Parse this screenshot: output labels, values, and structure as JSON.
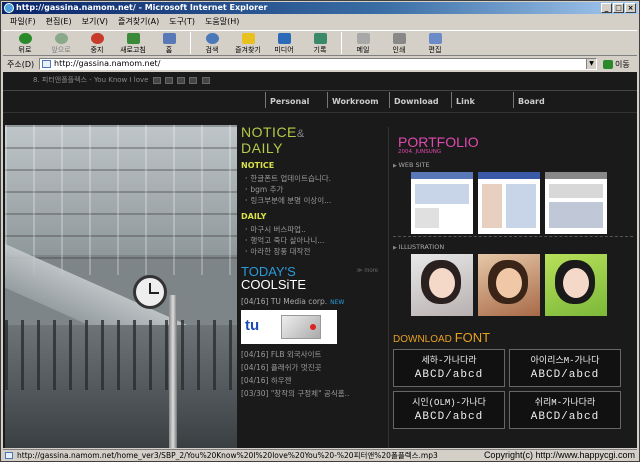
{
  "window": {
    "title": "http://gassina.namom.net/ - Microsoft Internet Explorer"
  },
  "menu": [
    "파일(F)",
    "편집(E)",
    "보기(V)",
    "즐겨찾기(A)",
    "도구(T)",
    "도움말(H)"
  ],
  "toolbar": [
    {
      "label": "뒤로",
      "icon": "back-icon",
      "color": "#2a8a2a"
    },
    {
      "label": "앞으로",
      "icon": "forward-icon",
      "color": "#8aa88a"
    },
    {
      "label": "중지",
      "icon": "stop-icon",
      "color": "#c83a2a"
    },
    {
      "label": "새로고침",
      "icon": "refresh-icon",
      "color": "#3a8a3a"
    },
    {
      "label": "홈",
      "icon": "home-icon",
      "color": "#5878b8"
    },
    {
      "label": "검색",
      "icon": "search-icon",
      "color": "#4a78b8"
    },
    {
      "label": "즐겨찾기",
      "icon": "favorites-icon",
      "color": "#e8c020"
    },
    {
      "label": "미디어",
      "icon": "media-icon",
      "color": "#2a6ab8"
    },
    {
      "label": "기록",
      "icon": "history-icon",
      "color": "#3a8a6a"
    },
    {
      "label": "메일",
      "icon": "mail-icon",
      "color": "#a8a8a8"
    },
    {
      "label": "인쇄",
      "icon": "print-icon",
      "color": "#888888"
    },
    {
      "label": "편집",
      "icon": "edit-icon",
      "color": "#6a8ac8"
    }
  ],
  "address": {
    "label": "주소(D)",
    "value": "http://gassina.namom.net/",
    "go_label": "이동"
  },
  "site": {
    "music": "8. 피터앤폴플렉스 - You Know I love",
    "nav": [
      "Personal",
      "Workroom",
      "Download",
      "Link",
      "Board"
    ],
    "notice": {
      "title": "NOTICE",
      "amp": "&",
      "title2": "DAILY",
      "notice_head": "NOTICE",
      "notice_items": [
        "한글폰트 업데이트습니다.",
        "bgm 추가",
        "링크부분에 분명 이상이..."
      ],
      "daily_head": "DAILY",
      "daily_items": [
        "마구시 버스파업..",
        "행억고 죽다 살아나니...",
        "아라한 장풍 대작전"
      ]
    },
    "cool": {
      "title1": "TODAY'S",
      "title2": "COOLSiTE",
      "more": "≫ more",
      "first": "[04/16] TU Media corp.",
      "new": "NEW",
      "img_text": "tu",
      "items": [
        "[04/16] FLB 외국사이트",
        "[04/16] 플래쉬가 멋진곳",
        "[04/16] 하우젠",
        "[03/30] \"창작의 구정체\" 공식홈.."
      ]
    },
    "portfolio": {
      "title": "PORTFOLIO",
      "sub": "2004. JUNSUNG",
      "web_label": "WEB SITE",
      "ill_label": "ILLUSTRATION"
    },
    "download": {
      "title1": "DOWNLOAD",
      "title2": "FONT",
      "fonts": [
        {
          "l1": "세하-가나다라",
          "l2": "ABCD/abcd"
        },
        {
          "l1": "아이리스M-가나다",
          "l2": "ABCD/abcd"
        },
        {
          "l1": "시인(OLM)-가나다",
          "l2": "ABCD/abcd"
        },
        {
          "l1": "쉬리M-가나다라",
          "l2": "ABCD/abcd"
        }
      ]
    }
  },
  "status": {
    "text": "http://gassina.namom.net/home_ver3/SBP_2/You%20Know%20I%20love%20You%20-%20피터앤%20폴플렉스.mp3",
    "copyright": "Copyright(c) http://www.happycgi.com"
  }
}
